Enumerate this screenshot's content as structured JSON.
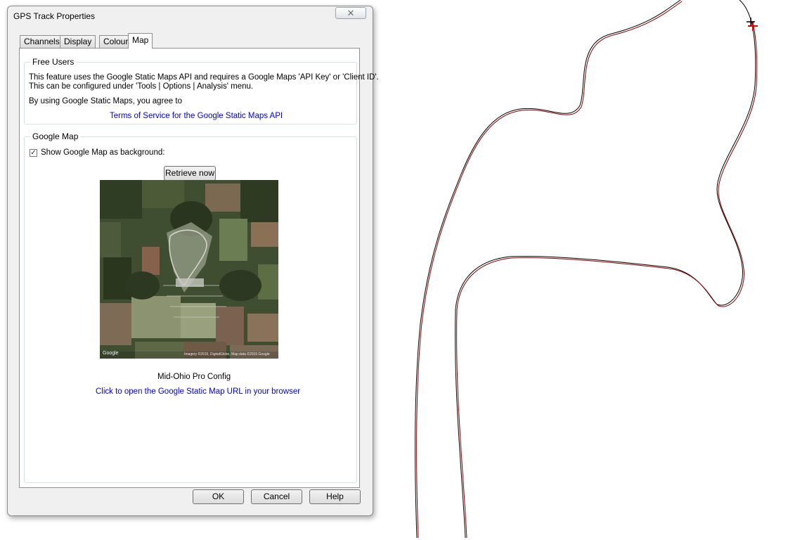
{
  "dialog": {
    "title": "GPS Track Properties",
    "close_glyph": "✕",
    "tabs": [
      "Channels",
      "Display",
      "Colour",
      "Map"
    ],
    "active_tab": "Map"
  },
  "free_users": {
    "legend": "Free Users",
    "line1": "This feature uses the Google Static Maps API and requires a Google Maps 'API Key' or 'Client ID'.",
    "line2": "This can be configured under 'Tools | Options | Analysis' menu.",
    "line3": "By using Google Static Maps, you agree to",
    "terms_link": "Terms of Service for the Google Static Maps API"
  },
  "google_map": {
    "legend": "Google Map",
    "show_checkbox_label": "Show Google Map as background:",
    "show_checked": true,
    "retrieve_button": "Retrieve now",
    "map_brand": "Google",
    "map_copyright": "Imagery ©2015, DigitalGlobe, Map data ©2015 Google",
    "map_caption": "Mid-Ohio Pro Config",
    "url_link": "Click to open the Google Static Map URL in your browser"
  },
  "footer": {
    "ok": "OK",
    "cancel": "Cancel",
    "help": "Help"
  },
  "colors": {
    "track_line": "#7a0000",
    "track_outline": "#000000",
    "cursor_marker": "#d40000",
    "link": "#0000e6"
  }
}
